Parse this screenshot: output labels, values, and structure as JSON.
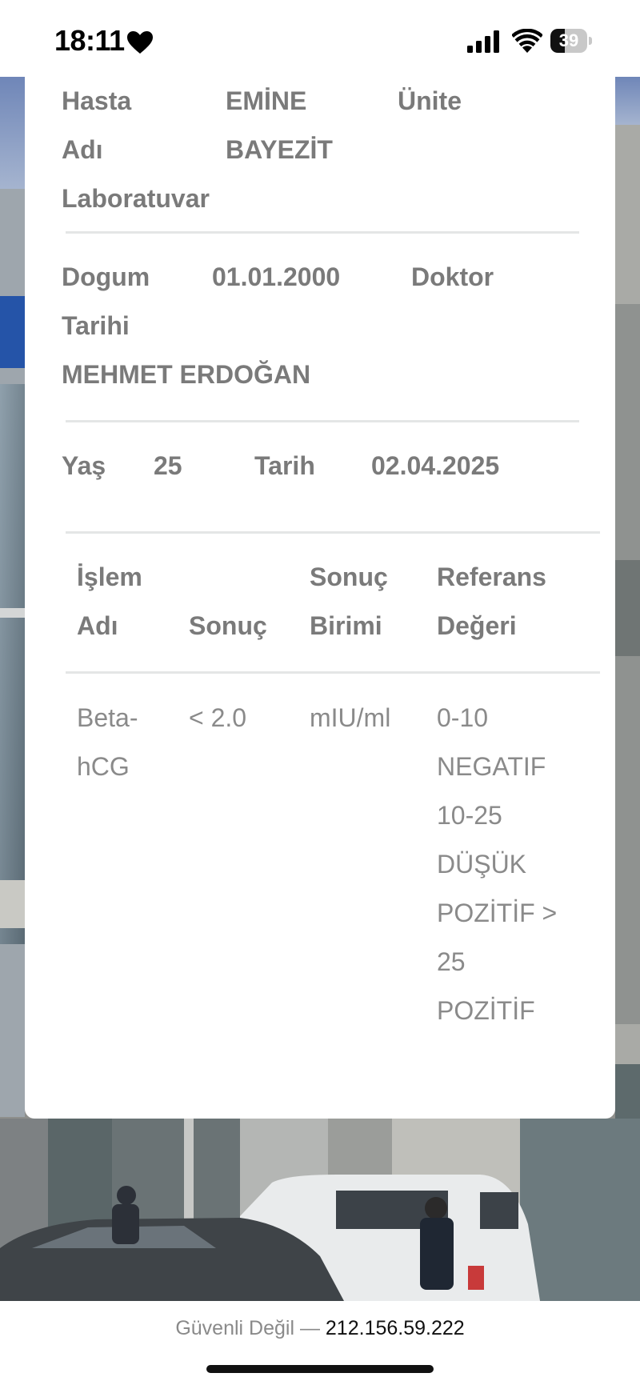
{
  "status_bar": {
    "time": "18:11",
    "battery_level": "39",
    "battery_fraction": 0.39
  },
  "patient": {
    "name_label_line1": "Hasta",
    "name_label_line2": "Adı",
    "name_value_line1": "EMİNE",
    "name_value_line2": "BAYEZİT",
    "unit_label": "Ünite",
    "unit_value": "Laboratuvar",
    "birth_label_line1": "Dogum",
    "birth_label_line2": "Tarihi",
    "birth_value": "01.01.2000",
    "doctor_label": "Doktor",
    "doctor_value": "MEHMET ERDOĞAN",
    "age_label": "Yaş",
    "age_value": "25",
    "date_label": "Tarih",
    "date_value": "02.04.2025"
  },
  "table": {
    "headers": {
      "procedure_line1": "İşlem",
      "procedure_line2": "Adı",
      "result": "Sonuç",
      "unit_line1": "Sonuç",
      "unit_line2": "Birimi",
      "reference_line1": "Referans",
      "reference_line2": "Değeri"
    },
    "rows": [
      {
        "procedure_line1": "Beta-",
        "procedure_line2": "hCG",
        "result": "< 2.0",
        "unit": "mIU/ml",
        "reference_lines": [
          "0-10",
          "NEGATIF",
          "10-25",
          "DÜŞÜK",
          "POZİTİF >",
          "25",
          "POZİTİF"
        ]
      }
    ]
  },
  "browser": {
    "security_warning": "Güvenli Değil —",
    "address": "212.156.59.222"
  },
  "colors": {
    "label_text": "#7a7a7a",
    "cell_text": "#8a8a8a",
    "divider": "#e4e6e6"
  }
}
